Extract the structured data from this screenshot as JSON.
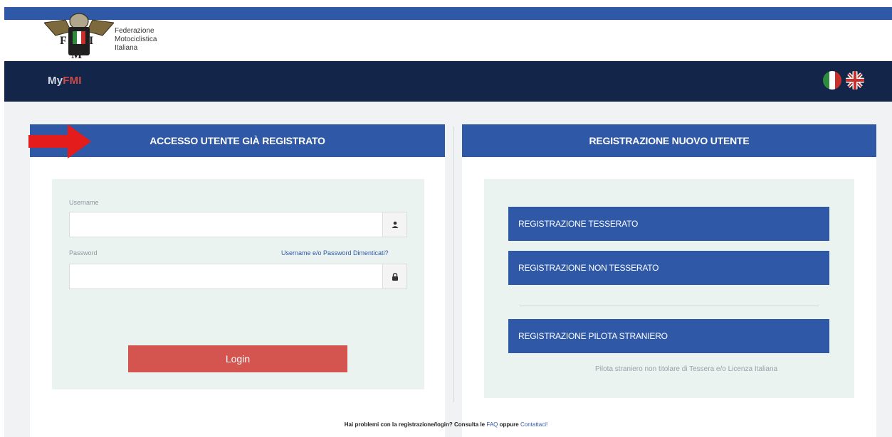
{
  "brand": {
    "org_lines": [
      "Federazione",
      "Motociclistica",
      "Italiana"
    ],
    "app_name_prefix": "My",
    "app_name_accent": "FMI"
  },
  "colors": {
    "primary": "#2f58a6",
    "navbar": "#13264a",
    "accent_red": "#d4544f",
    "form_bg": "#ebf3f1"
  },
  "languages": [
    {
      "code": "it",
      "icon": "italy-flag-icon"
    },
    {
      "code": "en",
      "icon": "uk-flag-icon"
    }
  ],
  "login": {
    "header": "ACCESSO UTENTE GIÀ REGISTRATO",
    "username_label": "Username",
    "username_value": "",
    "password_label": "Password",
    "password_value": "",
    "forgot_link": "Username e/o Password Dimenticati?",
    "button": "Login",
    "user_icon": "user-icon",
    "lock_icon": "lock-icon"
  },
  "register": {
    "header": "REGISTRAZIONE NUOVO UTENTE",
    "btn_tesserato": "REGISTRAZIONE TESSERATO",
    "btn_non_tesserato": "REGISTRAZIONE NON TESSERATO",
    "btn_straniero": "REGISTRAZIONE PILOTA STRANIERO",
    "note": "Pilota straniero non titolare di Tessera e/o Licenza Italiana"
  },
  "footer": {
    "text": "Hai problemi con la registrazione/login? Consulta le",
    "faq": "FAQ",
    "or": "oppure",
    "contact": "Contattaci!"
  }
}
